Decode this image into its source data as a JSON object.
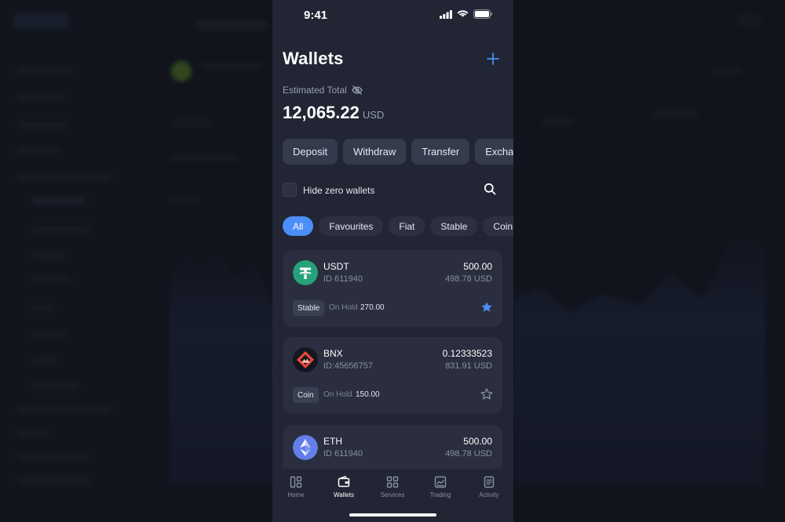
{
  "status_bar": {
    "time": "9:41"
  },
  "header": {
    "title": "Wallets",
    "add_label": "+"
  },
  "summary": {
    "label": "Estimated Total",
    "total": "12,065.22",
    "currency": "USD"
  },
  "actions": [
    "Deposit",
    "Withdraw",
    "Transfer",
    "Exchange"
  ],
  "hide_zero": {
    "label": "Hide zero wallets",
    "checked": false
  },
  "filters": [
    "All",
    "Favourites",
    "Fiat",
    "Stable",
    "Coins"
  ],
  "active_filter": "All",
  "wallets": [
    {
      "name": "USDT",
      "id": "ID 611940",
      "amount": "500.00",
      "usd": "498.78 USD",
      "tag": "Stable",
      "hold_label": "On Hold",
      "hold_value": "270.00",
      "favourite": true,
      "icon": "tether-icon",
      "color": "#26a17b"
    },
    {
      "name": "BNX",
      "id": "ID:45656757",
      "amount": "0.12333523",
      "usd": "831.91 USD",
      "tag": "Coin",
      "hold_label": "On Hold",
      "hold_value": "150.00",
      "favourite": false,
      "icon": "bnx-icon",
      "color": "#e8473a"
    },
    {
      "name": "ETH",
      "id": "ID 611940",
      "amount": "500.00",
      "usd": "498.78 USD",
      "tag": "",
      "hold_label": "",
      "hold_value": "",
      "favourite": false,
      "icon": "ethereum-icon",
      "color": "#627eea"
    }
  ],
  "tabs": [
    {
      "label": "Home",
      "icon": "home-icon"
    },
    {
      "label": "Wallets",
      "icon": "wallet-icon"
    },
    {
      "label": "Services",
      "icon": "grid-icon"
    },
    {
      "label": "Trading",
      "icon": "chart-icon"
    },
    {
      "label": "Activity",
      "icon": "document-icon"
    }
  ],
  "active_tab": "Wallets",
  "colors": {
    "accent": "#4b8ef7",
    "background": "#222533",
    "card": "#2a2e3e"
  }
}
